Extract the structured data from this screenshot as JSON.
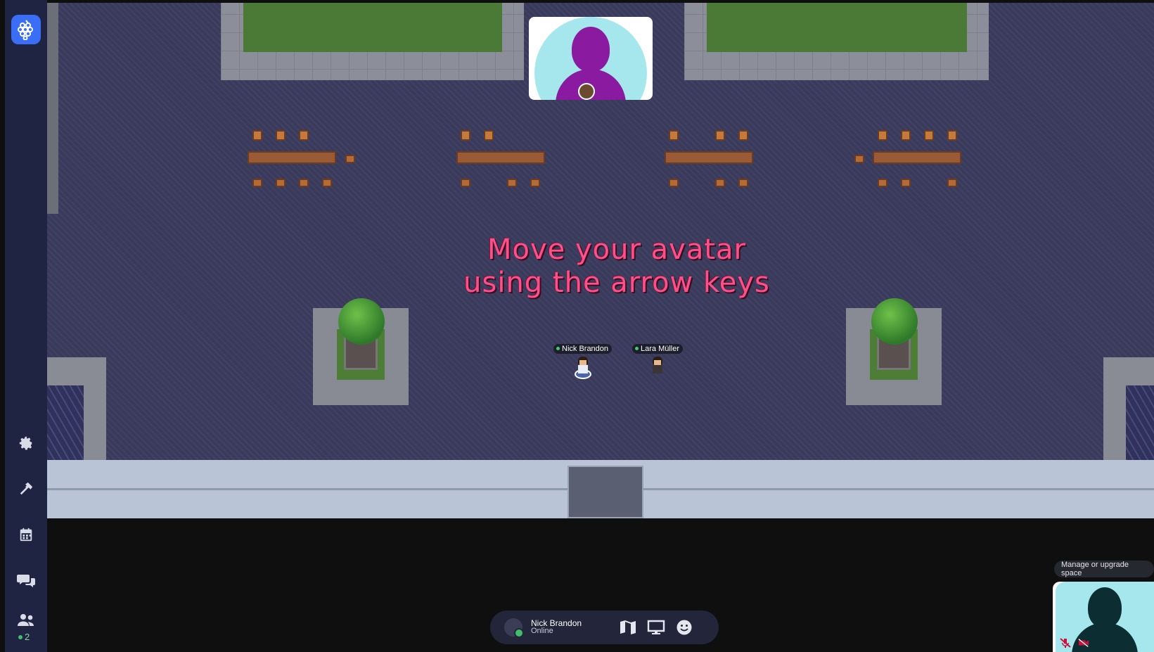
{
  "app": {
    "name": "Gather"
  },
  "sidebar": {
    "items": [
      {
        "name": "settings",
        "icon": "gear-icon"
      },
      {
        "name": "build",
        "icon": "hammer-icon"
      },
      {
        "name": "calendar",
        "icon": "calendar-icon"
      },
      {
        "name": "chat",
        "icon": "chat-icon"
      },
      {
        "name": "participants",
        "icon": "people-icon"
      }
    ],
    "online_count": "2"
  },
  "map": {
    "tutorial_line1": "Move your avatar",
    "tutorial_line2": "using the arrow keys",
    "players": [
      {
        "name": "Nick Brandon",
        "status": "online"
      },
      {
        "name": "Lara Müller",
        "status": "online"
      }
    ]
  },
  "bottom_bar": {
    "user_name": "Nick Brandon",
    "user_status": "Online",
    "buttons": [
      "map-icon",
      "screen-share-icon",
      "emoji-icon"
    ]
  },
  "corner": {
    "upgrade_label": "Manage or upgrade space"
  },
  "colors": {
    "sidebar_bg": "#1e2442",
    "accent": "#3b6ef6",
    "tutorial_text": "#ff4f88",
    "remote_avatar": "#8a1aa0",
    "self_avatar": "#0c2e33",
    "online": "#3fbf6a"
  }
}
